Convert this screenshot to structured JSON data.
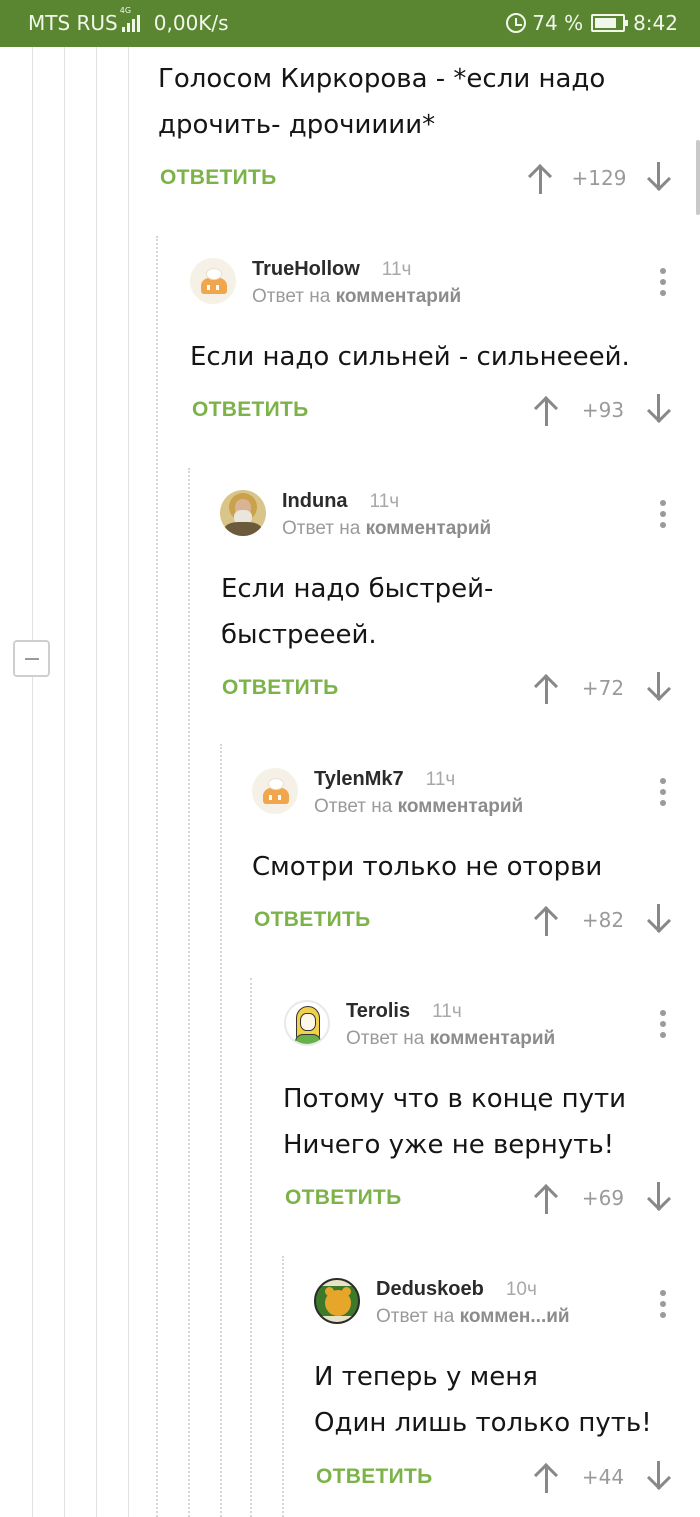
{
  "status_bar": {
    "carrier": "MTS RUS",
    "network": "4G",
    "speed": "0,00K/s",
    "battery": "74 %",
    "time": "8:42"
  },
  "reply_label": "ОТВЕТИТЬ",
  "reply_to_prefix": "Ответ на",
  "comments": [
    {
      "text": "Голосом Киркорова - *если надо дрочить- дрочииии*",
      "score": "+129"
    },
    {
      "username": "TrueHollow",
      "time": "11ч",
      "reply_to": "комментарий",
      "text": "Если надо сильней - сильнееей.",
      "score": "+93",
      "avatar": "cake-icon"
    },
    {
      "username": "Induna",
      "time": "11ч",
      "reply_to": "комментарий",
      "text": "Если надо быстрей-быстрееей.",
      "score": "+72",
      "avatar": "icon-portrait"
    },
    {
      "username": "TylenMk7",
      "time": "11ч",
      "reply_to": "комментарий",
      "text": "Смотри только не оторви",
      "score": "+82",
      "avatar": "cake-icon"
    },
    {
      "username": "Terolis",
      "time": "11ч",
      "reply_to": "комментарий",
      "text_line1": "Потому что в конце пути",
      "text_line2": "Ничего уже не вернуть!",
      "score": "+69",
      "avatar": "girl-cartoon"
    },
    {
      "username": "Deduskoeb",
      "time": "10ч",
      "reply_to": "коммен...ий",
      "text_line1": "И теперь у меня",
      "text_line2": "Один лишь только путь!",
      "score": "+44",
      "avatar": "bear-cartoon"
    }
  ]
}
